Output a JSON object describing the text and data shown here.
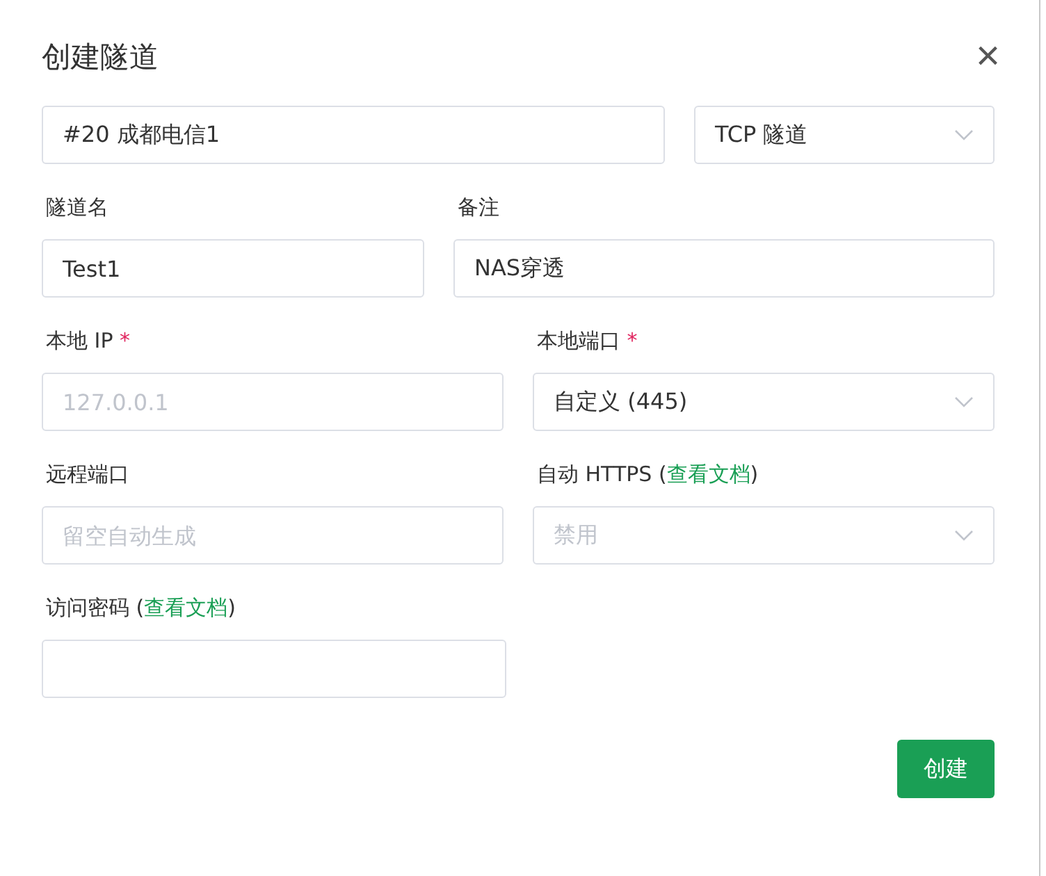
{
  "dialog": {
    "title": "创建隧道",
    "close": "×"
  },
  "rows": [
    {
      "fields": [
        {
          "kind": "input",
          "value": "#20 成都电信1"
        },
        {
          "kind": "select",
          "value": "TCP 隧道",
          "disabled": false
        }
      ]
    },
    {
      "fields": [
        {
          "kind": "input",
          "label": {
            "text": "隧道名"
          },
          "value": "Test1"
        },
        {
          "kind": "input",
          "label": {
            "text": "备注"
          },
          "value": "NAS穿透"
        }
      ]
    },
    {
      "fields": [
        {
          "kind": "input",
          "label": {
            "text": "本地 IP",
            "required_mark": "*"
          },
          "placeholder": "127.0.0.1"
        },
        {
          "kind": "select",
          "label": {
            "text": "本地端口",
            "required_mark": "*"
          },
          "value": "自定义 (445)",
          "disabled": false
        }
      ]
    },
    {
      "fields": [
        {
          "kind": "input",
          "label": {
            "text": "远程端口"
          },
          "placeholder": "留空自动生成"
        },
        {
          "kind": "select",
          "label": {
            "text": "自动 HTTPS (",
            "link": "查看文档",
            "suffix": ")"
          },
          "value": "禁用",
          "disabled": true
        }
      ]
    },
    {
      "fields": [
        {
          "kind": "input",
          "label": {
            "text": "访问密码 (",
            "link": "查看文档",
            "suffix": ")"
          }
        }
      ]
    }
  ],
  "submit_button": "创建"
}
